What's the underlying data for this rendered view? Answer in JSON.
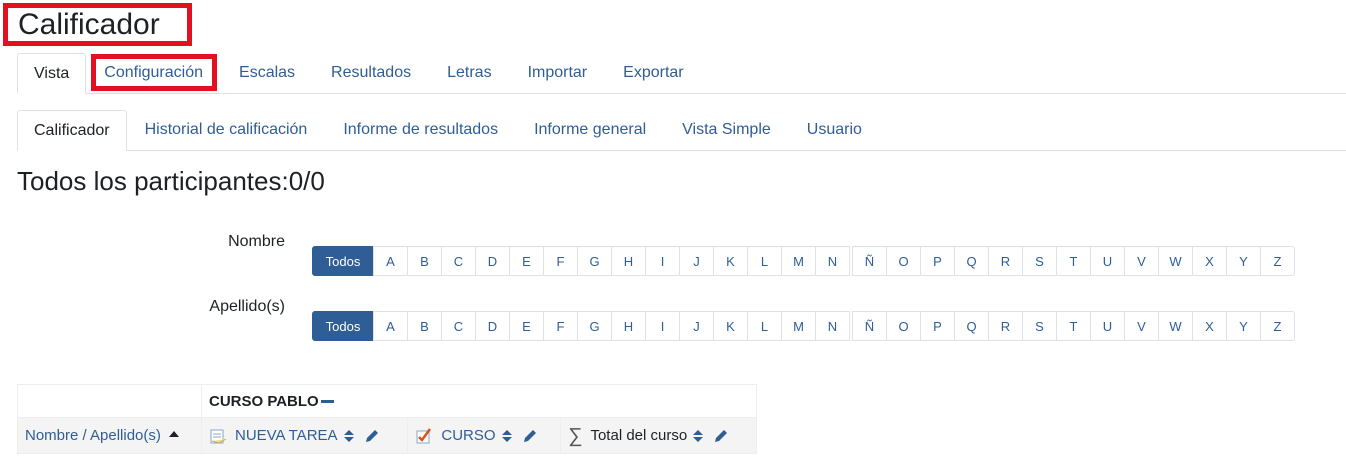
{
  "page": {
    "title": "Calificador",
    "subtitle": "Todos los participantes:0/0"
  },
  "nav_tabs": [
    {
      "label": "Vista",
      "active": true
    },
    {
      "label": "Configuración",
      "active": false
    },
    {
      "label": "Escalas",
      "active": false
    },
    {
      "label": "Resultados",
      "active": false
    },
    {
      "label": "Letras",
      "active": false
    },
    {
      "label": "Importar",
      "active": false
    },
    {
      "label": "Exportar",
      "active": false
    }
  ],
  "sub_tabs": [
    {
      "label": "Calificador",
      "active": true
    },
    {
      "label": "Historial de calificación",
      "active": false
    },
    {
      "label": "Informe de resultados",
      "active": false
    },
    {
      "label": "Informe general",
      "active": false
    },
    {
      "label": "Vista Simple",
      "active": false
    },
    {
      "label": "Usuario",
      "active": false
    }
  ],
  "initials_filter": {
    "all_label": "Todos",
    "letters": [
      "A",
      "B",
      "C",
      "D",
      "E",
      "F",
      "G",
      "H",
      "I",
      "J",
      "K",
      "L",
      "M",
      "N",
      "Ñ",
      "O",
      "P",
      "Q",
      "R",
      "S",
      "T",
      "U",
      "V",
      "W",
      "X",
      "Y",
      "Z"
    ],
    "firstname_label": "Nombre",
    "lastname_label": "Apellido(s)"
  },
  "grader_table": {
    "course_name": "CURSO PABLO",
    "user_column": "Nombre / Apellido(s)",
    "items": [
      {
        "name": "NUEVA TAREA",
        "icon": "assignment-icon"
      },
      {
        "name": "CURSO",
        "icon": "quiz-icon"
      },
      {
        "name": "Total del curso",
        "icon": "sigma-icon"
      }
    ]
  },
  "colors": {
    "accent": "#2f5d95",
    "highlight": "#e3101f"
  }
}
